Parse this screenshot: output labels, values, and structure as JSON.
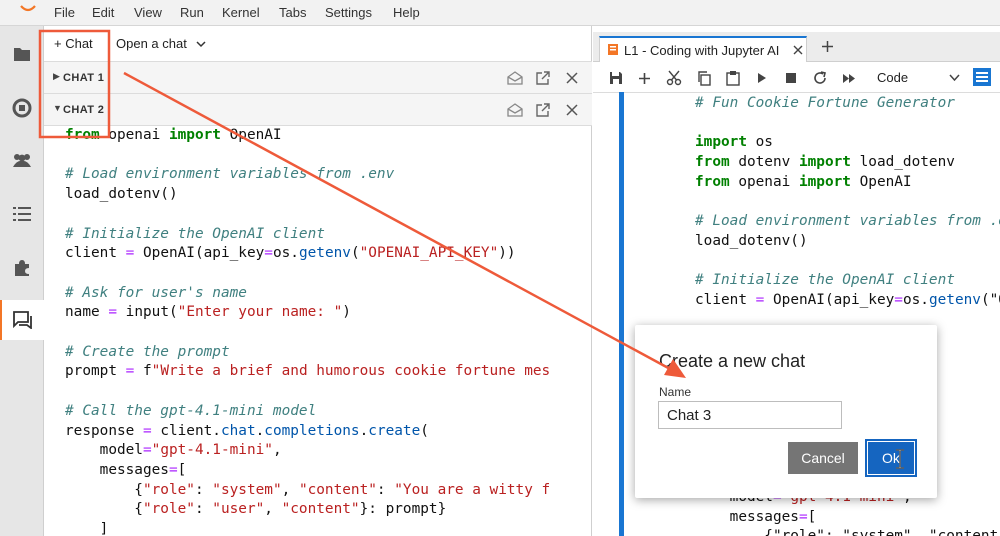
{
  "menubar": {
    "items": [
      "File",
      "Edit",
      "View",
      "Run",
      "Kernel",
      "Tabs",
      "Settings",
      "Help"
    ]
  },
  "activity_bar": {
    "icons": [
      "folder-icon",
      "running-icon",
      "users-icon",
      "toc-icon",
      "extension-icon",
      "chat-icon"
    ],
    "active": "chat-icon"
  },
  "chat_panel": {
    "new_chat_label": "+ Chat",
    "open_chat_label": "Open a chat",
    "sections": [
      {
        "title": "CHAT 1",
        "expanded": false
      },
      {
        "title": "CHAT 2",
        "expanded": true
      }
    ],
    "code_lines": [
      [
        [
          "kw",
          "from"
        ],
        [
          "t",
          " openai "
        ],
        [
          "kw",
          "import"
        ],
        [
          "t",
          " OpenAI"
        ]
      ],
      [],
      [
        [
          "com",
          "# Load environment variables from .env"
        ]
      ],
      [
        [
          "t",
          "load_dotenv()"
        ]
      ],
      [],
      [
        [
          "com",
          "# Initialize the OpenAI client"
        ]
      ],
      [
        [
          "t",
          "client "
        ],
        [
          "op",
          "="
        ],
        [
          "t",
          " OpenAI(api_key"
        ],
        [
          "op",
          "="
        ],
        [
          "t",
          "os."
        ],
        [
          "attr",
          "getenv"
        ],
        [
          "t",
          "("
        ],
        [
          "str",
          "\"OPENAI_API_KEY\""
        ],
        [
          "t",
          "))"
        ]
      ],
      [],
      [
        [
          "com",
          "# Ask for user's name"
        ]
      ],
      [
        [
          "t",
          "name "
        ],
        [
          "op",
          "="
        ],
        [
          "t",
          " input("
        ],
        [
          "str",
          "\"Enter your name: \""
        ],
        [
          "t",
          ")"
        ]
      ],
      [],
      [
        [
          "com",
          "# Create the prompt"
        ]
      ],
      [
        [
          "t",
          "prompt "
        ],
        [
          "op",
          "="
        ],
        [
          "t",
          " f"
        ],
        [
          "str",
          "\"Write a brief and humorous cookie fortune mes"
        ]
      ],
      [],
      [
        [
          "com",
          "# Call the gpt-4.1-mini model"
        ]
      ],
      [
        [
          "t",
          "response "
        ],
        [
          "op",
          "="
        ],
        [
          "t",
          " client."
        ],
        [
          "attr",
          "chat"
        ],
        [
          "t",
          "."
        ],
        [
          "attr",
          "completions"
        ],
        [
          "t",
          "."
        ],
        [
          "attr",
          "create"
        ],
        [
          "t",
          "("
        ]
      ],
      [
        [
          "t",
          "    model"
        ],
        [
          "op",
          "="
        ],
        [
          "str",
          "\"gpt-4.1-mini\""
        ],
        [
          "t",
          ","
        ]
      ],
      [
        [
          "t",
          "    messages"
        ],
        [
          "op",
          "="
        ],
        [
          "t",
          "["
        ]
      ],
      [
        [
          "t",
          "        {"
        ],
        [
          "str",
          "\"role\""
        ],
        [
          "t",
          ": "
        ],
        [
          "str",
          "\"system\""
        ],
        [
          "t",
          ", "
        ],
        [
          "str",
          "\"content\""
        ],
        [
          "t",
          ": "
        ],
        [
          "str",
          "\"You are a witty f"
        ]
      ],
      [
        [
          "t",
          "        {"
        ],
        [
          "str",
          "\"role\""
        ],
        [
          "t",
          ": "
        ],
        [
          "str",
          "\"user\""
        ],
        [
          "t",
          ", "
        ],
        [
          "str",
          "\"content\""
        ],
        [
          "t",
          "}: prompt}"
        ]
      ],
      [
        [
          "t",
          "    ]"
        ]
      ]
    ]
  },
  "notebook": {
    "tab_title": "L1 - Coding with Jupyter AI",
    "cell_type": "Code",
    "code_lines": [
      [
        [
          "com",
          "# Fun Cookie Fortune Generator"
        ]
      ],
      [],
      [
        [
          "kw",
          "import"
        ],
        [
          "t",
          " os"
        ]
      ],
      [
        [
          "kw",
          "from"
        ],
        [
          "t",
          " dotenv "
        ],
        [
          "kw",
          "import"
        ],
        [
          "t",
          " load_dotenv"
        ]
      ],
      [
        [
          "kw",
          "from"
        ],
        [
          "t",
          " openai "
        ],
        [
          "kw",
          "import"
        ],
        [
          "t",
          " OpenAI"
        ]
      ],
      [],
      [
        [
          "com",
          "# Load environment variables from .e"
        ]
      ],
      [
        [
          "t",
          "load_dotenv()"
        ]
      ],
      [],
      [
        [
          "com",
          "# Initialize the OpenAI client"
        ]
      ],
      [
        [
          "t",
          "client "
        ],
        [
          "op",
          "="
        ],
        [
          "t",
          " OpenAI(api_key"
        ],
        [
          "op",
          "="
        ],
        [
          "t",
          "os."
        ],
        [
          "attr",
          "getenv"
        ],
        [
          "t",
          "(\"O"
        ]
      ],
      [],
      [],
      [
        [
          "t",
          "                  e: \")"
        ]
      ],
      [],
      [],
      [
        [
          "t",
          "                  humorou"
        ]
      ],
      [],
      [],
      [
        [
          "t",
          "                  etions.cre"
        ]
      ],
      [
        [
          "t",
          "    model"
        ],
        [
          "op",
          "="
        ],
        [
          "str",
          "\"gpt-4.1-mini\""
        ],
        [
          "t",
          ","
        ]
      ],
      [
        [
          "t",
          "    messages"
        ],
        [
          "op",
          "="
        ],
        [
          "t",
          "["
        ]
      ],
      [
        [
          "t",
          "        {\"role\": \"system\", \"content\""
        ]
      ]
    ]
  },
  "dialog": {
    "title": "Create a new chat",
    "name_label": "Name",
    "name_value": "Chat 3",
    "cancel_label": "Cancel",
    "ok_label": "Ok"
  },
  "annotation": {
    "color": "#ee5a3a"
  }
}
